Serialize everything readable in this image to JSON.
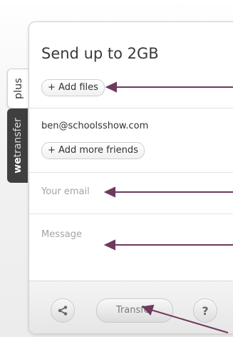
{
  "sidebar": {
    "plus_tab": "plus",
    "wetransfer_tab_bold": "we",
    "wetransfer_tab_rest": "transfer"
  },
  "form": {
    "title": "Send up to 2GB",
    "add_files_label": "+ Add files",
    "friend_email": "ben@schoolsshow.com",
    "add_friends_label": "+ Add more friends",
    "your_email_placeholder": "Your email",
    "message_placeholder": "Message"
  },
  "footer": {
    "transfer_label": "Transfer",
    "help_label": "?"
  },
  "colors": {
    "arrow": "#6e3a5e",
    "panel_bg": "#ffffff",
    "sidebar_dark": "#3f3f3f"
  },
  "icons": [
    "share-icon",
    "help-icon"
  ]
}
